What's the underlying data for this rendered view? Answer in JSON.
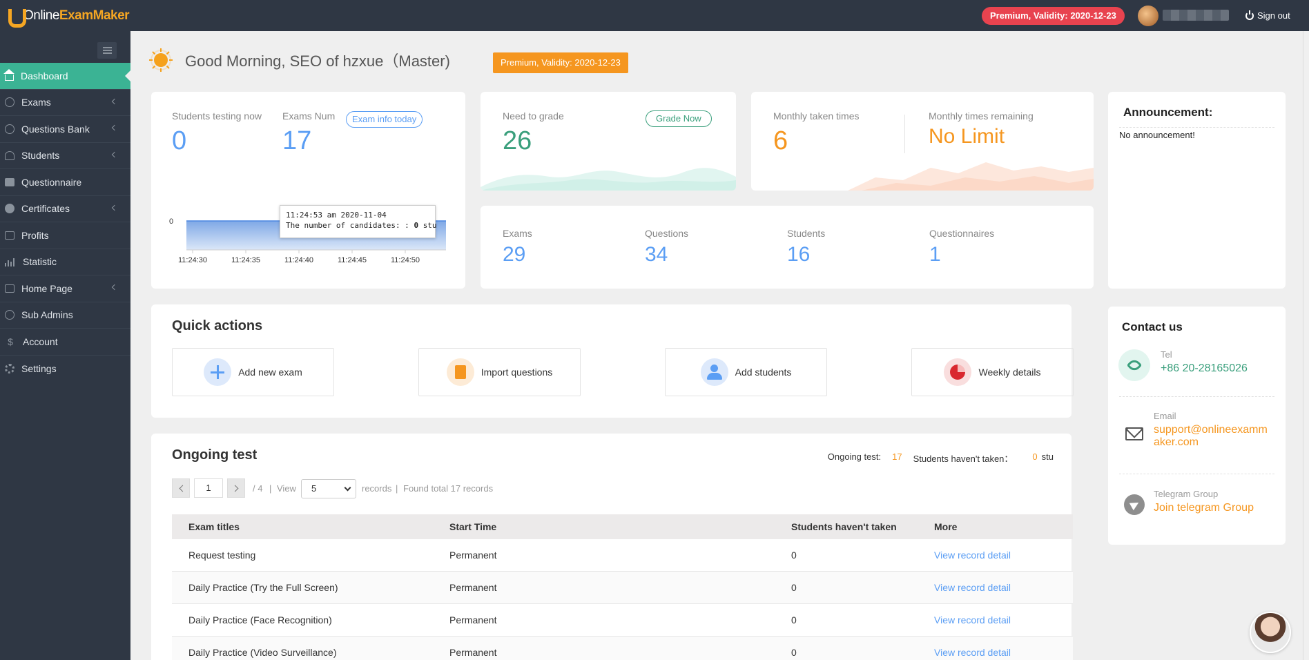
{
  "app": {
    "logo_online": "Online",
    "logo_exam": "ExamMaker",
    "premium_pill": "Premium, Validity: 2020-12-23",
    "sign_out": "Sign out"
  },
  "sidebar": {
    "items": [
      {
        "label": "Dashboard",
        "icon": "home-icon",
        "active": true
      },
      {
        "label": "Exams",
        "icon": "check-circle-icon"
      },
      {
        "label": "Questions Bank",
        "icon": "question-circle-icon"
      },
      {
        "label": "Students",
        "icon": "person-icon"
      },
      {
        "label": "Questionnaire",
        "icon": "checkbox-icon"
      },
      {
        "label": "Certificates",
        "icon": "certificate-icon"
      },
      {
        "label": "Profits",
        "icon": "card-icon"
      },
      {
        "label": "Statistic",
        "icon": "bar-chart-icon"
      },
      {
        "label": "Home Page",
        "icon": "home-page-icon"
      },
      {
        "label": "Sub Admins",
        "icon": "question-circle-icon"
      },
      {
        "label": "Account",
        "icon": "dollar-icon"
      },
      {
        "label": "Settings",
        "icon": "gear-icon"
      }
    ]
  },
  "greeting": {
    "text": "Good Morning, SEO of hzxue（Master)",
    "badge": "Premium, Validity: 2020-12-23"
  },
  "testing_card": {
    "students_label": "Students testing now",
    "students_value": "0",
    "exams_label": "Exams Num",
    "exams_value": "17",
    "exam_info_btn": "Exam info today",
    "chart_y_label": "0",
    "chart_x_labels": [
      "11:24:30",
      "11:24:35",
      "11:24:40",
      "11:24:45",
      "11:24:50"
    ],
    "tooltip_time": "11:24:53 am 2020-11-04",
    "tooltip_label": "The number of candidates: :",
    "tooltip_value": "0",
    "tooltip_unit": "stu"
  },
  "grade_card": {
    "label": "Need to grade",
    "value": "26",
    "button": "Grade Now"
  },
  "monthly_card": {
    "taken_label": "Monthly taken times",
    "taken_value": "6",
    "remaining_label": "Monthly times remaining",
    "remaining_value": "No Limit"
  },
  "stats": [
    {
      "label": "Exams",
      "value": "29"
    },
    {
      "label": "Questions",
      "value": "34"
    },
    {
      "label": "Students",
      "value": "16"
    },
    {
      "label": "Questionnaires",
      "value": "1"
    }
  ],
  "announcement": {
    "title": "Announcement:",
    "text": "No announcement!"
  },
  "quick_actions": {
    "title": "Quick actions",
    "items": [
      {
        "label": "Add new exam",
        "icon": "plus-icon"
      },
      {
        "label": "Import questions",
        "icon": "document-icon"
      },
      {
        "label": "Add students",
        "icon": "user-icon"
      },
      {
        "label": "Weekly details",
        "icon": "pie-icon"
      }
    ]
  },
  "ongoing": {
    "title": "Ongoing test",
    "ongoing_label": "Ongoing test:",
    "ongoing_value": "17",
    "not_taken_label": "Students haven't taken：",
    "not_taken_value": "0",
    "not_taken_unit": "stu",
    "page": "1",
    "pages": "/ 4",
    "view_label": "View",
    "per_page": "5",
    "records_label": "records",
    "found_label": "Found total 17 records",
    "columns": [
      "Exam titles",
      "Start Time",
      "Students haven't taken",
      "More"
    ],
    "rows": [
      {
        "title": "Request testing",
        "start": "Permanent",
        "not_taken": "0",
        "more": "View record detail"
      },
      {
        "title": "Daily Practice (Try the Full Screen)",
        "start": "Permanent",
        "not_taken": "0",
        "more": "View record detail"
      },
      {
        "title": "Daily Practice (Face Recognition)",
        "start": "Permanent",
        "not_taken": "0",
        "more": "View record detail"
      },
      {
        "title": "Daily Practice (Video Surveillance)",
        "start": "Permanent",
        "not_taken": "0",
        "more": "View record detail"
      }
    ]
  },
  "contact": {
    "title": "Contact us",
    "tel_label": "Tel",
    "tel_value": "+86 20-28165026",
    "email_label": "Email",
    "email_line1": "support@onlineexamm",
    "email_line2": "aker.com",
    "telegram_label": "Telegram Group",
    "telegram_value": "Join telegram Group"
  },
  "colors": {
    "sidebar": "#2f3744",
    "active": "#3bb394",
    "blue": "#5b9ef4",
    "green": "#3a9f7c",
    "orange": "#f5961f",
    "red_pill": "#e8434f"
  }
}
